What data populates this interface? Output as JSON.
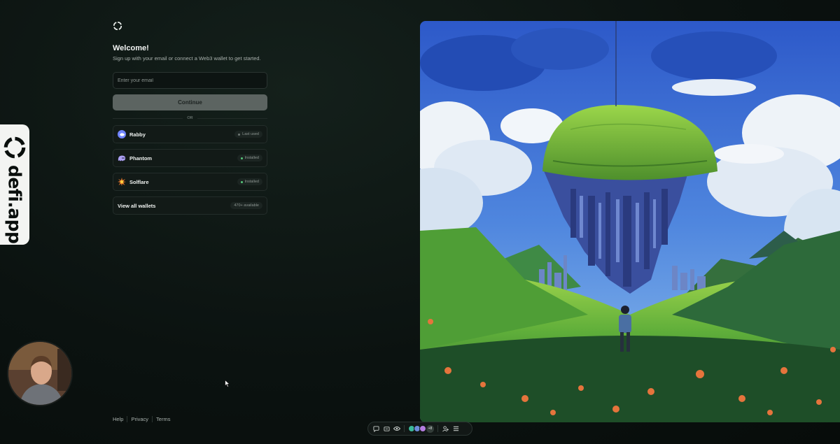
{
  "brand": {
    "wordmark": "defi.app"
  },
  "login": {
    "title": "Welcome!",
    "subtitle": "Sign up with your email or connect a Web3 wallet to get started.",
    "email_placeholder": "Enter your email",
    "continue_label": "Continue",
    "divider_label": "OR",
    "wallets": [
      {
        "name": "Rabby",
        "badge": "Last used",
        "icon": "rabby-icon",
        "color": "#7084ff"
      },
      {
        "name": "Phantom",
        "badge": "Installed",
        "icon": "phantom-icon",
        "color": "#ab9ff2"
      },
      {
        "name": "Solflare",
        "badge": "Installed",
        "icon": "solflare-icon",
        "color": "#fc822b"
      }
    ],
    "view_all": {
      "label": "View all wallets",
      "badge": "470+ available"
    }
  },
  "footer": {
    "help": "Help",
    "privacy": "Privacy",
    "terms": "Terms"
  },
  "toolbar": {
    "more_count": "+8"
  },
  "colors": {
    "background": "#0a110f",
    "accent_green": "#57c77a",
    "button": "#5c6461"
  }
}
